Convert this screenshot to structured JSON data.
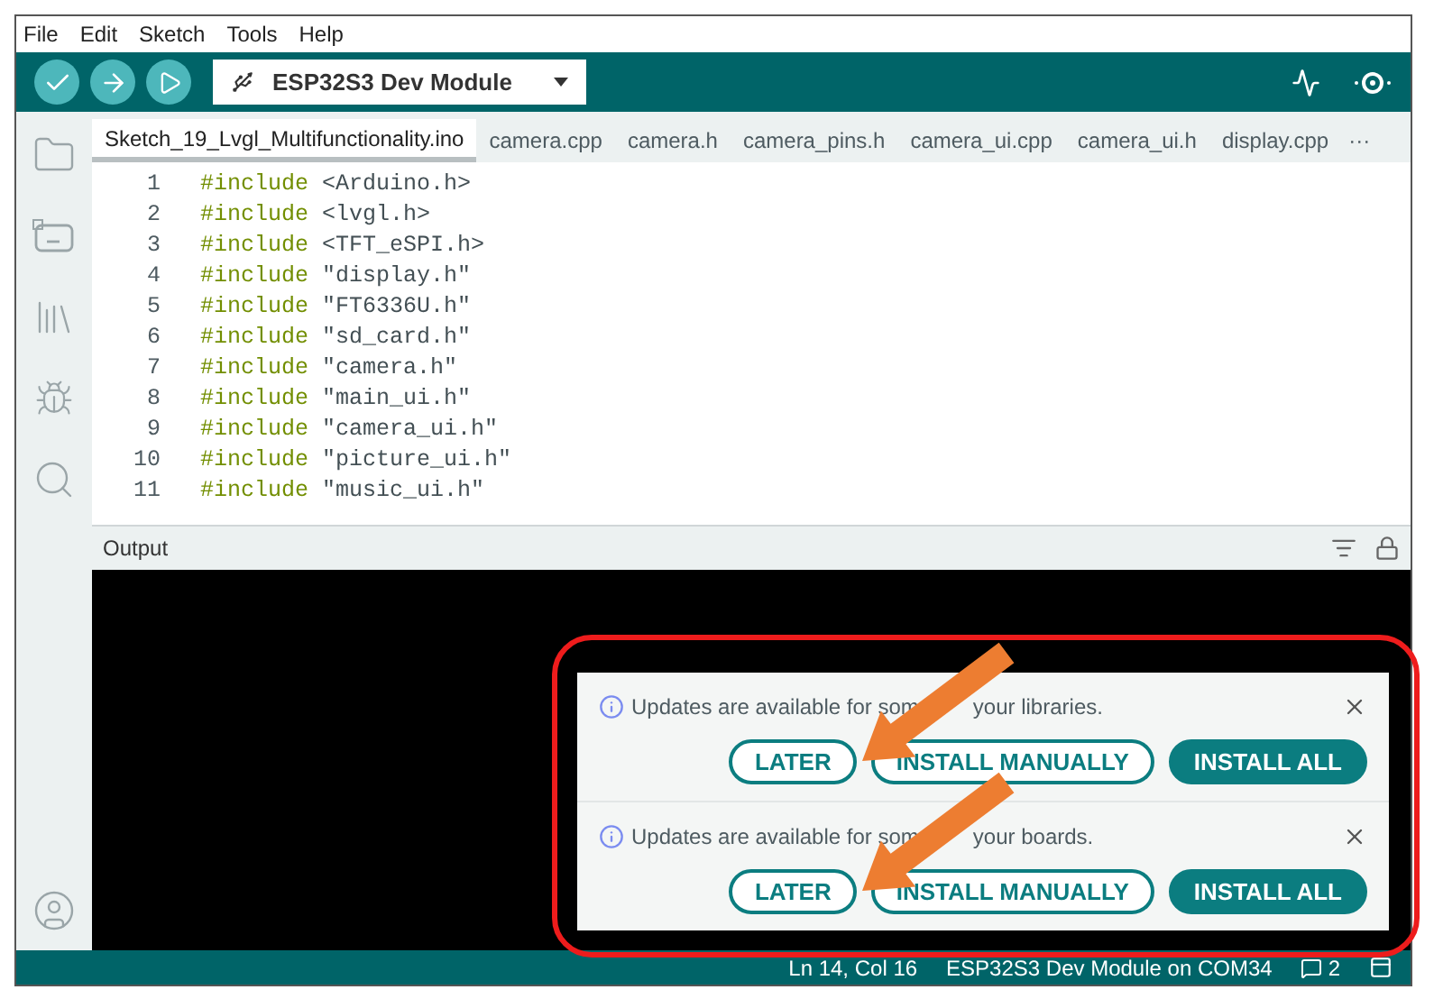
{
  "menu": [
    "File",
    "Edit",
    "Sketch",
    "Tools",
    "Help"
  ],
  "board_selector": {
    "label": "ESP32S3 Dev Module"
  },
  "tabs": [
    {
      "label": "Sketch_19_Lvgl_Multifunctionality.ino",
      "selected": true
    },
    {
      "label": "camera.cpp",
      "selected": false
    },
    {
      "label": "camera.h",
      "selected": false
    },
    {
      "label": "camera_pins.h",
      "selected": false
    },
    {
      "label": "camera_ui.cpp",
      "selected": false
    },
    {
      "label": "camera_ui.h",
      "selected": false
    },
    {
      "label": "display.cpp",
      "selected": false
    }
  ],
  "more_tabs": "···",
  "code_lines": [
    {
      "number": "1",
      "directive": "#include",
      "target": "<Arduino.h>"
    },
    {
      "number": "2",
      "directive": "#include",
      "target": "<lvgl.h>"
    },
    {
      "number": "3",
      "directive": "#include",
      "target": "<TFT_eSPI.h>"
    },
    {
      "number": "4",
      "directive": "#include",
      "target": "\"display.h\""
    },
    {
      "number": "5",
      "directive": "#include",
      "target": "\"FT6336U.h\""
    },
    {
      "number": "6",
      "directive": "#include",
      "target": "\"sd_card.h\""
    },
    {
      "number": "7",
      "directive": "#include",
      "target": "\"camera.h\""
    },
    {
      "number": "8",
      "directive": "#include",
      "target": "\"main_ui.h\""
    },
    {
      "number": "9",
      "directive": "#include",
      "target": "\"camera_ui.h\""
    },
    {
      "number": "10",
      "directive": "#include",
      "target": "\"picture_ui.h\""
    },
    {
      "number": "11",
      "directive": "#include",
      "target": "\"music_ui.h\""
    }
  ],
  "output": {
    "title": "Output"
  },
  "notifications": [
    {
      "text_before": "Updates are available for som",
      "text_after": "your libraries.",
      "buttons": [
        {
          "label": "LATER",
          "kind": "outline"
        },
        {
          "label": "INSTALL MANUALLY",
          "kind": "outline"
        },
        {
          "label": "INSTALL ALL",
          "kind": "filled"
        }
      ]
    },
    {
      "text_before": "Updates are available for som",
      "text_after": "your boards.",
      "buttons": [
        {
          "label": "LATER",
          "kind": "outline"
        },
        {
          "label": "INSTALL MANUALLY",
          "kind": "outline"
        },
        {
          "label": "INSTALL ALL",
          "kind": "filled"
        }
      ]
    }
  ],
  "status_bar": {
    "position": "Ln 14, Col 16",
    "board": "ESP32S3 Dev Module on COM34",
    "notification_count": "2"
  }
}
